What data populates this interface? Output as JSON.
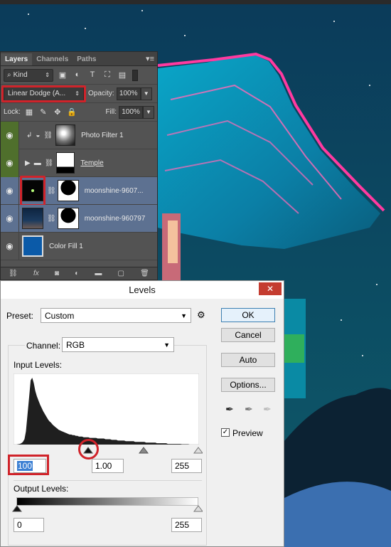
{
  "layers_panel": {
    "tabs": [
      "Layers",
      "Channels",
      "Paths"
    ],
    "kind_label": "Kind",
    "blend_mode": "Linear Dodge (A...",
    "opacity_label": "Opacity:",
    "opacity_value": "100%",
    "lock_label": "Lock:",
    "fill_label": "Fill:",
    "fill_value": "100%",
    "layers": [
      {
        "name": "Photo Filter 1"
      },
      {
        "name": "Temple"
      },
      {
        "name": "moonshine-9607..."
      },
      {
        "name": "moonshine-960797"
      },
      {
        "name": "Color Fill 1"
      }
    ]
  },
  "levels_dialog": {
    "title": "Levels",
    "preset_label": "Preset:",
    "preset_value": "Custom",
    "channel_label": "Channel:",
    "channel_value": "RGB",
    "input_levels_label": "Input Levels:",
    "input_black": "100",
    "input_gamma": "1.00",
    "input_white": "255",
    "output_levels_label": "Output Levels:",
    "output_black": "0",
    "output_white": "255",
    "buttons": {
      "ok": "OK",
      "cancel": "Cancel",
      "auto": "Auto",
      "options": "Options..."
    },
    "preview_label": "Preview",
    "preview_checked": true
  },
  "colors": {
    "accent_red": "#d0232a",
    "selected_layer": "#5d7191",
    "panel_bg": "#535353"
  },
  "histogram": [
    0,
    0,
    0,
    0.5,
    1,
    2,
    4,
    8,
    20,
    45,
    70,
    96,
    100,
    92,
    80,
    72,
    66,
    60,
    55,
    50,
    46,
    42,
    38,
    35,
    33,
    30,
    28,
    26,
    24,
    22,
    21,
    20,
    19,
    18,
    17,
    16,
    15,
    15,
    14,
    14,
    13,
    13,
    12,
    12,
    12,
    11,
    11,
    11,
    11,
    10,
    10,
    10,
    10,
    10,
    9,
    9,
    9,
    9,
    9,
    8,
    8,
    8,
    8,
    7,
    7,
    7,
    7,
    6,
    6,
    6,
    6,
    6,
    5,
    5,
    5,
    5,
    5,
    5,
    4,
    4,
    4,
    4,
    4,
    4,
    4,
    3,
    3,
    3,
    3,
    3,
    3,
    3,
    2,
    2,
    2,
    2,
    2,
    2,
    2,
    1,
    1,
    1,
    1,
    1,
    1,
    1,
    1,
    1,
    0.5,
    0.5,
    0.5,
    0.5,
    0.5,
    0,
    0,
    0,
    0,
    0,
    0,
    0
  ]
}
